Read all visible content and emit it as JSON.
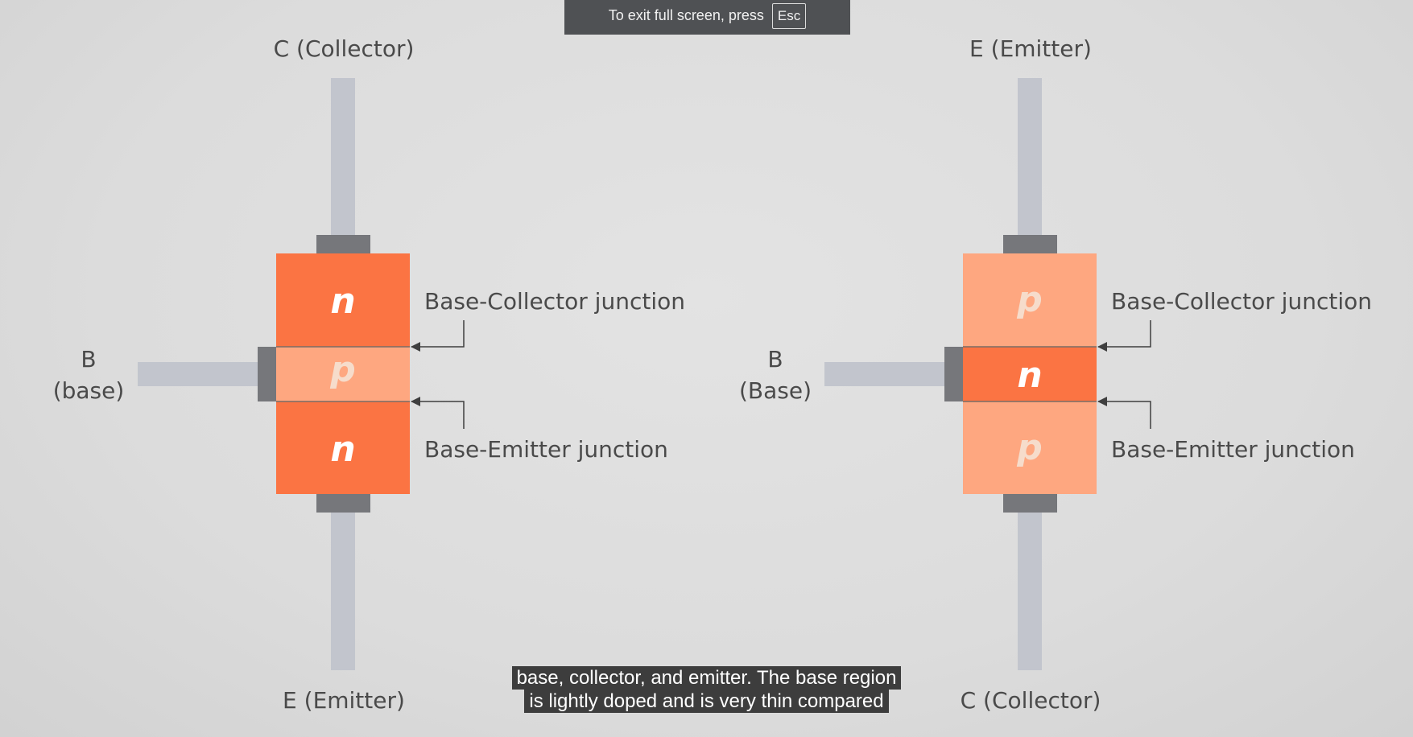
{
  "fullscreen_toast": {
    "text": "To exit full screen, press",
    "key": "Esc"
  },
  "diagrams": {
    "npn": {
      "top_terminal": "C (Collector)",
      "bottom_terminal": "E (Emitter)",
      "base_letter": "B",
      "base_name": "(base)",
      "regions": [
        "n",
        "p",
        "n"
      ],
      "upper_junction": "Base-Collector junction",
      "lower_junction": "Base-Emitter junction"
    },
    "pnp": {
      "top_terminal": "E (Emitter)",
      "bottom_terminal": "C (Collector)",
      "base_letter": "B",
      "base_name": "(Base)",
      "regions": [
        "p",
        "n",
        "p"
      ],
      "upper_junction": "Base-Collector junction",
      "lower_junction": "Base-Emitter junction"
    }
  },
  "captions": {
    "line1": "base, collector, and emitter. The base region",
    "line2": "is lightly doped and is very thin compared"
  },
  "colors": {
    "heavy_doped": "#fb7443",
    "light_doped": "#fea780",
    "lead": "#c2c5cd",
    "contact": "#76777b",
    "background": "#dedede"
  }
}
